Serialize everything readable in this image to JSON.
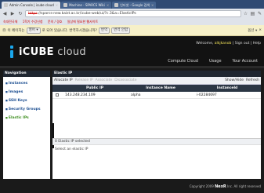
{
  "browser": {
    "tabs": [
      {
        "label": "Admin Console | icube cloud",
        "active": true
      },
      {
        "label": "Machine - SPARCS Wiki",
        "active": false
      },
      {
        "label": "인터넷 - Google 검색",
        "active": false
      }
    ],
    "url_scheme": "https",
    "url_rest": "://sparcs-new.kaist.ac.kr/icube-web/ui/?c.3&a=ElasticIPs",
    "bookmarks": [
      "숙대전국체",
      "1학기 수강신청",
      "문의 / 경호",
      "일상에 필요한 웹사이트"
    ],
    "translate_text": "이 페이지는",
    "translate_lang": "영어 ▾",
    "translate_question": "로 되어 있습니다. 번역하시겠습니까?",
    "translate_button": "번역",
    "translate_never": "번역 안함",
    "translate_options": "옵션 ▾"
  },
  "header": {
    "welcome_prefix": "Welcome,",
    "username": "alkjkanob",
    "signout": "Sign out",
    "help": "Help",
    "logo_brand": "iCUBE",
    "logo_cloud": "cloud",
    "nav": [
      "Compute Cloud",
      "Usage",
      "Your Account"
    ]
  },
  "sidebar": {
    "title": "Navigation",
    "items": [
      {
        "label": "Instances",
        "active": false
      },
      {
        "label": "Images",
        "active": false
      },
      {
        "label": "SSH Keys",
        "active": false
      },
      {
        "label": "Security Groups",
        "active": false
      },
      {
        "label": "Elastic IPs",
        "active": true
      }
    ]
  },
  "panel": {
    "title": "Elastic IP",
    "toolbar": {
      "allocate": "Allocate IP",
      "release": "Release IP",
      "associate": "Associate",
      "disassociate": "Disassociate",
      "show_hide": "Show/Hide",
      "refresh": "Refresh"
    },
    "columns": [
      "Public IP",
      "Instance Name",
      "Instanceld"
    ],
    "rows": [
      {
        "ip": "143.248.234.109",
        "name": "alpha",
        "id": "i-02284697"
      }
    ],
    "detail_title": "0 Elastic IP selected",
    "detail_body": "Select an elastic IP"
  },
  "footer": {
    "copyright": "Copyright 2009",
    "brand": "NexR",
    "rights": "Inc. All right reserved"
  }
}
